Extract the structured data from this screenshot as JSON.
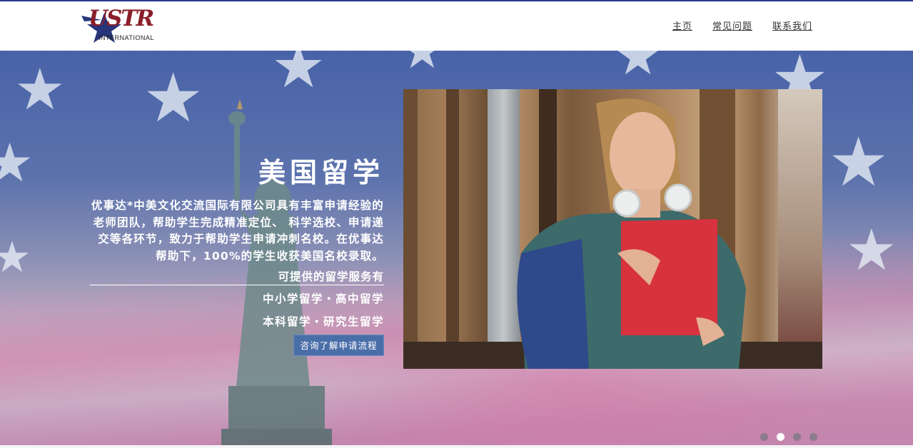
{
  "brand": {
    "logo_text": "USTR",
    "logo_subtitle": "INTERNATIONAL"
  },
  "nav": {
    "items": [
      {
        "label": "主页"
      },
      {
        "label": "常见问题"
      },
      {
        "label": "联系我们"
      }
    ]
  },
  "hero": {
    "headline": "美国留学",
    "description": "优事达*中美文化交流国际有限公司具有丰富申请经验的老师团队，帮助学生完成精准定位、 科学选校、申请递交等各环节，致力于帮助学生申请冲刺名校。在优事达帮助下，100%的学生收获美国名校录取。",
    "services_title": "可提供的留学服务有",
    "services": [
      "中小学留学・高中留学",
      "本科留学・研究生留学"
    ],
    "cta_label": "咨询了解申请流程"
  },
  "carousel": {
    "slide_count": 4,
    "active_index": 1
  },
  "colors": {
    "accent_blue": "#4a6ea8",
    "top_bar": "#2b3a8f",
    "logo_red": "#8a1f2a"
  }
}
